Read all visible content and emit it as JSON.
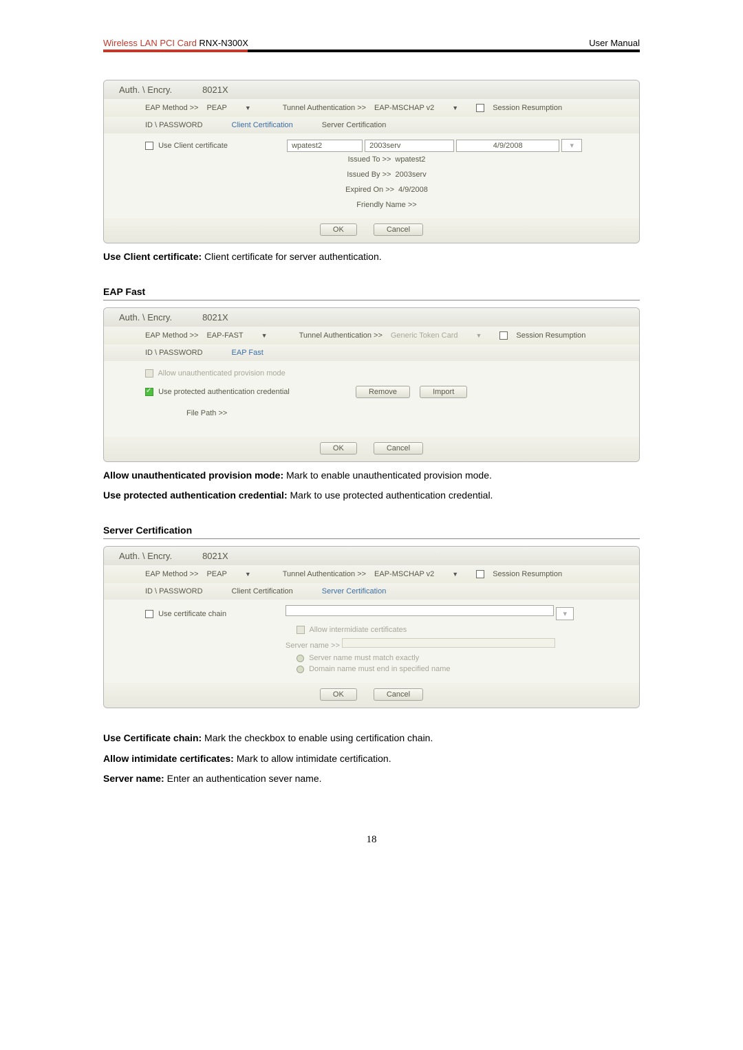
{
  "header": {
    "product": "Wireless LAN PCI Card",
    "model": " RNX-N300X",
    "right": "User Manual"
  },
  "dlg1": {
    "tab_auth": "Auth. \\ Encry.",
    "tab_8021x": "8021X",
    "eap_method_label": "EAP Method >>",
    "eap_method_value": "PEAP",
    "tunnel_auth_label": "Tunnel Authentication >>",
    "tunnel_auth_value": "EAP-MSCHAP v2",
    "session_resumption": "Session Resumption",
    "tab_idpw": "ID \\ PASSWORD",
    "tab_client_cert": "Client Certification",
    "tab_server_cert": "Server Certification",
    "use_client_cert": "Use Client certificate",
    "cert_cell1": "wpatest2",
    "cert_cell2": "2003serv",
    "cert_cell3": "4/9/2008",
    "issued_to_label": "Issued To >>",
    "issued_to_value": "wpatest2",
    "issued_by_label": "Issued By >>",
    "issued_by_value": "2003serv",
    "expired_label": "Expired On >>",
    "expired_value": "4/9/2008",
    "friendly_label": "Friendly Name >>",
    "ok": "OK",
    "cancel": "Cancel"
  },
  "desc1_bold": "Use Client certificate:",
  "desc1_text": " Client certificate for server authentication.",
  "section2_title": "EAP Fast",
  "dlg2": {
    "tab_auth": "Auth. \\ Encry.",
    "tab_8021x": "8021X",
    "eap_method_label": "EAP Method >>",
    "eap_method_value": "EAP-FAST",
    "tunnel_auth_label": "Tunnel Authentication >>",
    "tunnel_auth_value": "Generic Token Card",
    "session_resumption": "Session Resumption",
    "tab_idpw": "ID \\ PASSWORD",
    "tab_eapfast": "EAP Fast",
    "allow_unauth": "Allow unauthenticated provision mode",
    "use_protected": "Use protected authentication credential",
    "remove": "Remove",
    "import": "Import",
    "file_path_label": "File Path >>",
    "ok": "OK",
    "cancel": "Cancel"
  },
  "desc2a_bold": "Allow unauthenticated provision mode:",
  "desc2a_text": " Mark to enable unauthenticated provision mode.",
  "desc2b_bold": "Use protected authentication credential:",
  "desc2b_text": " Mark to use protected authentication credential.",
  "section3_title": "Server Certification",
  "dlg3": {
    "tab_auth": "Auth. \\ Encry.",
    "tab_8021x": "8021X",
    "eap_method_label": "EAP Method >>",
    "eap_method_value": "PEAP",
    "tunnel_auth_label": "Tunnel Authentication >>",
    "tunnel_auth_value": "EAP-MSCHAP v2",
    "session_resumption": "Session Resumption",
    "tab_idpw": "ID \\ PASSWORD",
    "tab_client_cert": "Client Certification",
    "tab_server_cert": "Server Certification",
    "use_cert_chain": "Use certificate chain",
    "allow_intermediate": "Allow intermidiate certificates",
    "server_name_label": "Server name >>",
    "radio1": "Server name must match exactly",
    "radio2": "Domain name must end in specified name",
    "ok": "OK",
    "cancel": "Cancel"
  },
  "desc3a_bold": "Use Certificate chain:",
  "desc3a_text": " Mark the checkbox to enable using certification chain.",
  "desc3b_bold": "Allow intimidate certificates:",
  "desc3b_text": " Mark to allow intimidate certification.",
  "desc3c_bold": "Server name:",
  "desc3c_text": " Enter an authentication sever name.",
  "page_number": "18"
}
